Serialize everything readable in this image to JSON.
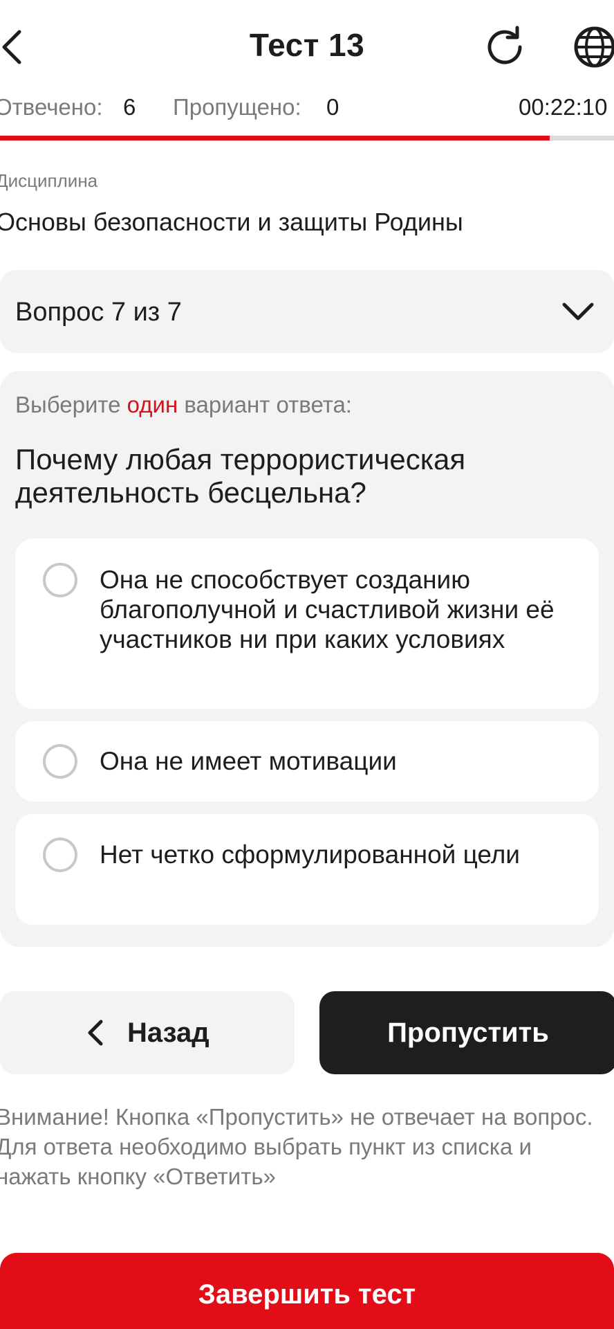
{
  "header": {
    "title": "Тест 13",
    "back_icon": "chevron-left-icon",
    "refresh_icon": "refresh-icon",
    "language_icon": "globe-icon"
  },
  "stats": {
    "answered_label": "Отвечено:",
    "answered_value": "6",
    "skipped_label": "Пропущено:",
    "skipped_value": "0",
    "timer": "00:22:10"
  },
  "progress": {
    "fraction": 0.895,
    "color": "#e30d18"
  },
  "discipline": {
    "label": "Дисциплина",
    "value": "Основы безопасности и защиты Родины"
  },
  "question_selector": {
    "label": "Вопрос 7 из 7"
  },
  "question": {
    "instruction_prefix": "Выберите",
    "instruction_accent": "один",
    "instruction_suffix": "вариант ответа:",
    "text": "Почему любая террористическая деятельность бесцельна?",
    "options": [
      {
        "text": "Она не способствует созданию благополучной и счастливой жизни её участников ни при каких условиях"
      },
      {
        "text": "Она не имеет мотивации"
      },
      {
        "text": "Нет четко сформулированной цели"
      }
    ]
  },
  "buttons": {
    "back_label": "Назад",
    "skip_label": "Пропустить",
    "finish_label": "Завершить тест"
  },
  "notice": "Внимание! Кнопка «Пропустить» не отвечает на вопрос. Для ответа необходимо выбрать пункт из списка и нажать кнопку «Ответить»",
  "colors": {
    "accent": "#e30d18",
    "dark_button": "#1e1e1e",
    "card_bg": "#f3f3f3"
  }
}
